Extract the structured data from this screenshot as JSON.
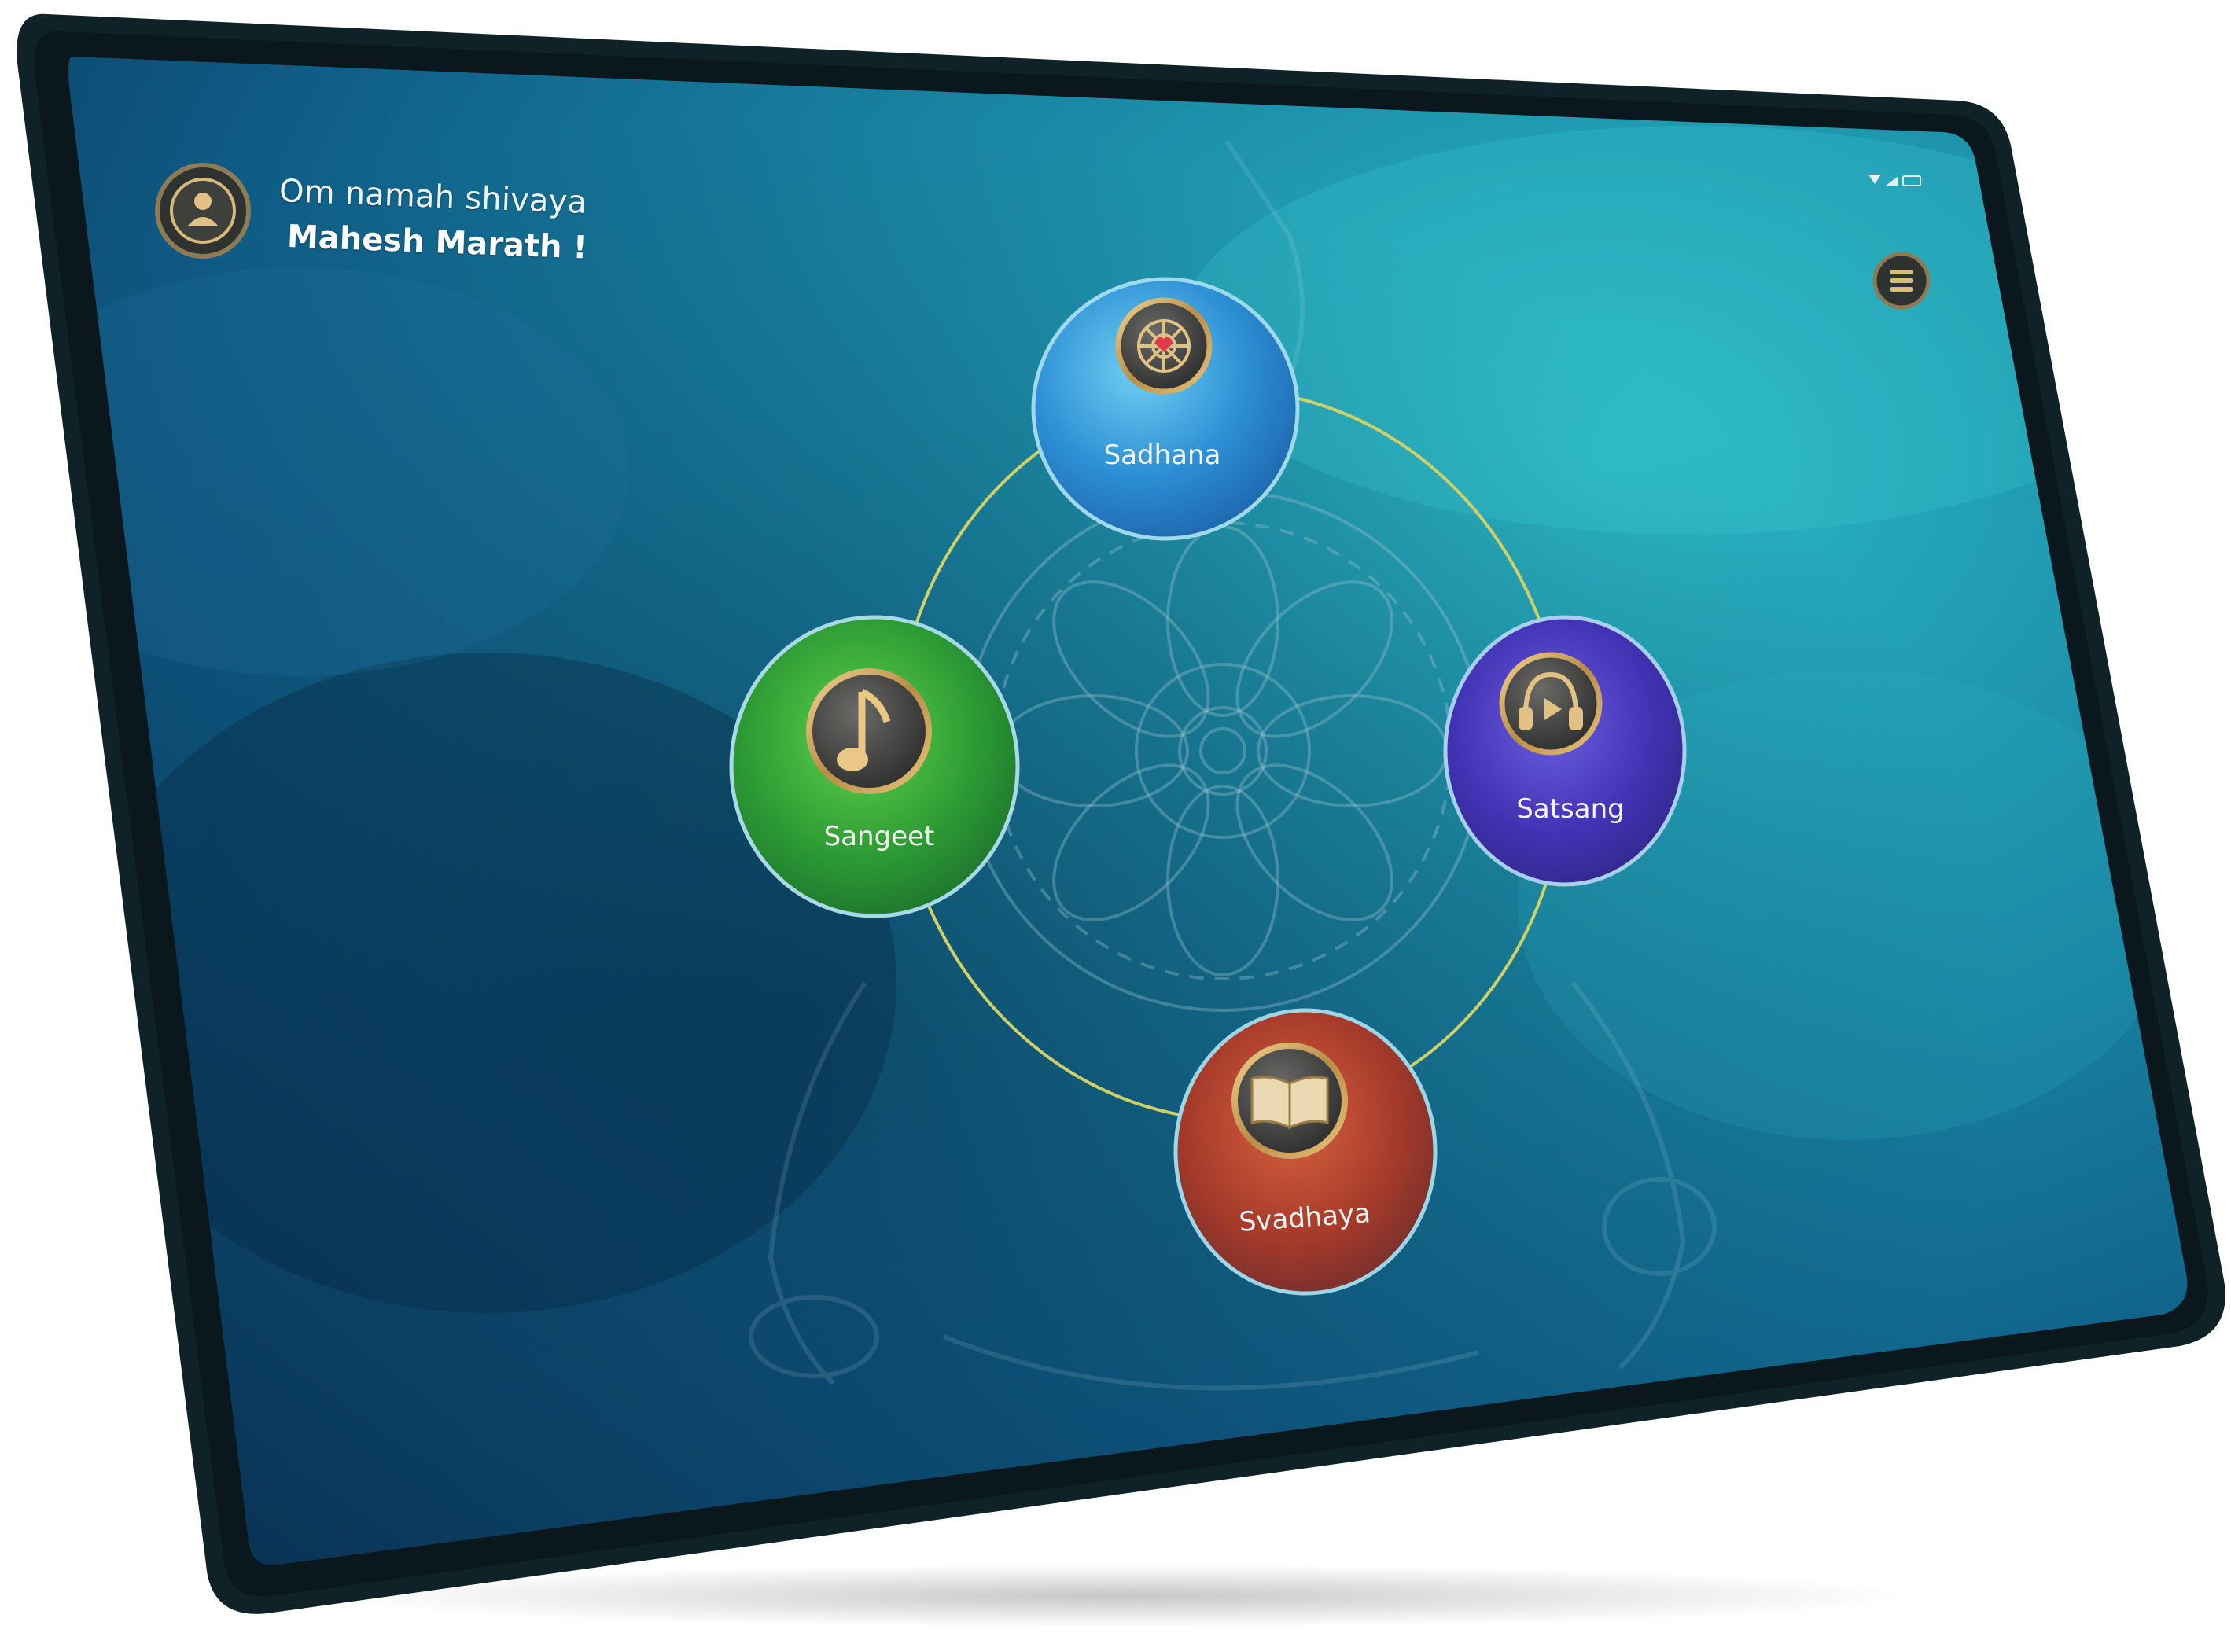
{
  "header": {
    "greeting": "Om namah shivaya",
    "username": "Mahesh Marath !",
    "avatar_icon": "user-avatar-icon",
    "menu_icon": "menu-grid-icon"
  },
  "status_bar": {
    "icons": [
      "wifi-icon",
      "signal-icon",
      "battery-icon"
    ]
  },
  "wheel": {
    "nodes": [
      {
        "label": "Sadhana",
        "icon": "mandala-icon",
        "color": "#3aa0dc"
      },
      {
        "label": "Sangeet",
        "icon": "music-note-icon",
        "color": "#2f9f3a"
      },
      {
        "label": "Satsang",
        "icon": "headphones-play-icon",
        "color": "#4a3fb8"
      },
      {
        "label": "Svadhaya",
        "icon": "open-book-icon",
        "color": "#b5452f"
      }
    ]
  },
  "colors": {
    "screen_dark": "#0b3a5c",
    "screen_light": "#1fa2b4",
    "bezel": "#0d1f25",
    "ring": "#c9c85a",
    "icon_gold": "#c9a35a"
  }
}
